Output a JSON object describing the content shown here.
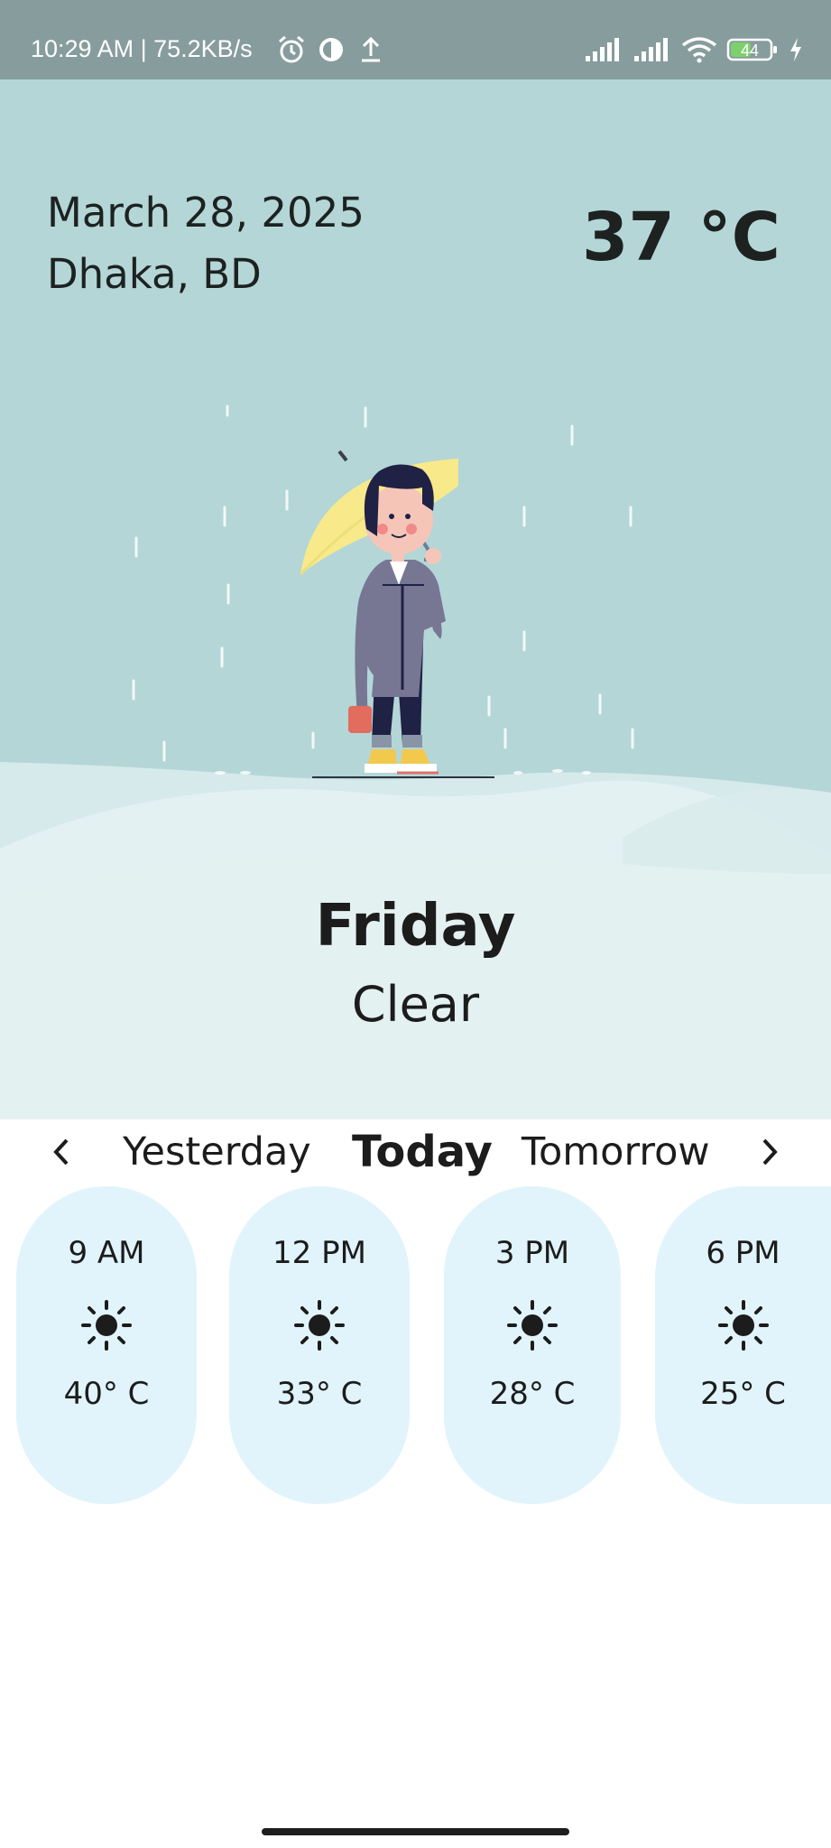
{
  "status_bar": {
    "text": "10:29 AM | 75.2KB/s",
    "battery": "44",
    "icons_left": [
      "alarm-icon",
      "data-saver-icon",
      "upload-icon"
    ],
    "icons_right": [
      "signal-icon",
      "signal-icon",
      "wifi-icon",
      "battery-icon",
      "charging-icon"
    ]
  },
  "weather": {
    "date": "March 28, 2025",
    "location": "Dhaka, BD",
    "temperature": "37 °C",
    "day": "Friday",
    "condition": "Clear"
  },
  "day_selector": {
    "tabs": [
      "Yesterday",
      "Today",
      "Tomorrow"
    ],
    "selected": "Today",
    "prev_icon": "chevron-left-icon",
    "next_icon": "chevron-right-icon"
  },
  "hourly": [
    {
      "time": "9 AM",
      "icon": "sun-icon",
      "temp": "40° C"
    },
    {
      "time": "12 PM",
      "icon": "sun-icon",
      "temp": "33° C"
    },
    {
      "time": "3 PM",
      "icon": "sun-icon",
      "temp": "28° C"
    },
    {
      "time": "6 PM",
      "icon": "sun-icon",
      "temp": "25° C"
    }
  ],
  "colors": {
    "status_bar": "#879c9d",
    "sky": "#b4d6d7",
    "card": "#e1f4fc",
    "umbrella": "#f8e98b"
  }
}
